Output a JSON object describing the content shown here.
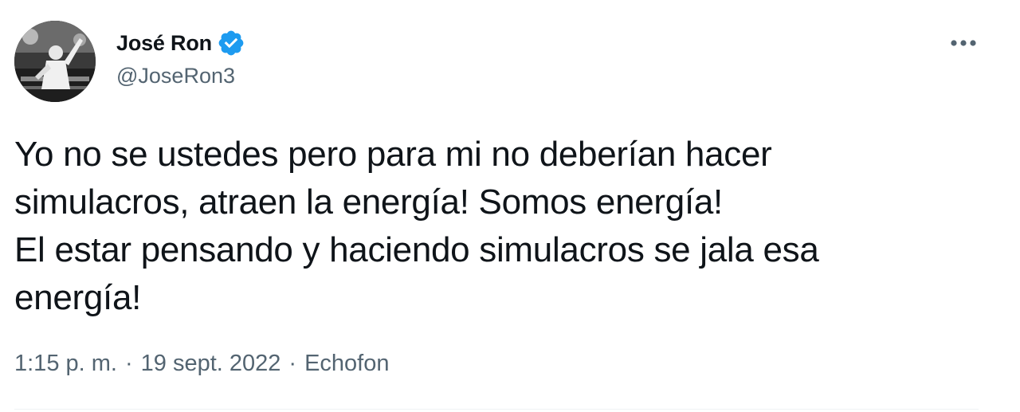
{
  "author": {
    "display_name": "José Ron",
    "handle": "@JoseRon3",
    "verified": true,
    "avatar_icon": "profile-photo"
  },
  "more_icon": "ellipsis-icon",
  "tweet": {
    "text": "Yo no se ustedes pero para mi no deberían hacer\nsimulacros, atraen la energía! Somos energía!\nEl estar pensando y haciendo simulacros se jala esa\nenergía!"
  },
  "meta": {
    "time": "1:15 p. m.",
    "separator": "·",
    "date": "19 sept. 2022",
    "source": "Echofon"
  },
  "colors": {
    "text": "#0f1419",
    "secondary": "#536471",
    "verified": "#1d9bf0",
    "divider": "#eff3f4"
  }
}
